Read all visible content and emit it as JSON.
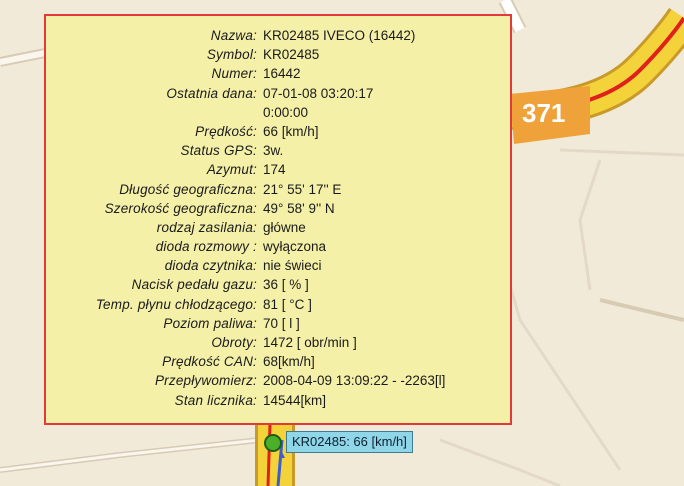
{
  "map": {
    "road_number": "371",
    "colors": {
      "background": "#f2ead9",
      "road_yellow": "#f4d23a",
      "road_red": "#e0201a",
      "route_blue": "#3b5fcf",
      "badge_orange": "#f0a23a"
    }
  },
  "tooltip": {
    "rows": [
      {
        "label": "Nazwa:",
        "value": "KR02485 IVECO (16442)"
      },
      {
        "label": "Symbol:",
        "value": "KR02485"
      },
      {
        "label": "Numer:",
        "value": "16442"
      },
      {
        "label": "Ostatnia dana:",
        "value": "07-01-08 03:20:17"
      },
      {
        "label": "",
        "value": "0:00:00"
      },
      {
        "label": "Prędkość:",
        "value": "66 [km/h]"
      },
      {
        "label": "Status GPS:",
        "value": "3w."
      },
      {
        "label": "Azymut:",
        "value": "174"
      },
      {
        "label": "Długość geograficzna:",
        "value": "21° 55' 17'' E"
      },
      {
        "label": "Szerokość geograficzna:",
        "value": "49° 58' 9'' N"
      },
      {
        "label": "rodzaj zasilania:",
        "value": "główne"
      },
      {
        "label": "dioda rozmowy :",
        "value": "wyłączona"
      },
      {
        "label": "dioda czytnika:",
        "value": "nie świeci"
      },
      {
        "label": "Nacisk pedału gazu:",
        "value": "36 [ % ]"
      },
      {
        "label": "Temp. płynu chłodzącego:",
        "value": "81 [ °C ]"
      },
      {
        "label": "Poziom paliwa:",
        "value": "70 [ l ]"
      },
      {
        "label": "Obroty:",
        "value": "1472 [ obr/min ]"
      },
      {
        "label": "Prędkość CAN:",
        "value": "68[km/h]"
      },
      {
        "label": "Przepływomierz:",
        "value": "2008-04-09 13:09:22 - -2263[l]"
      },
      {
        "label": "Stan licznika:",
        "value": "14544[km]"
      }
    ]
  },
  "vehicle": {
    "label": "KR02485: 66 [km/h]",
    "marker_color": "#4caf2a"
  }
}
